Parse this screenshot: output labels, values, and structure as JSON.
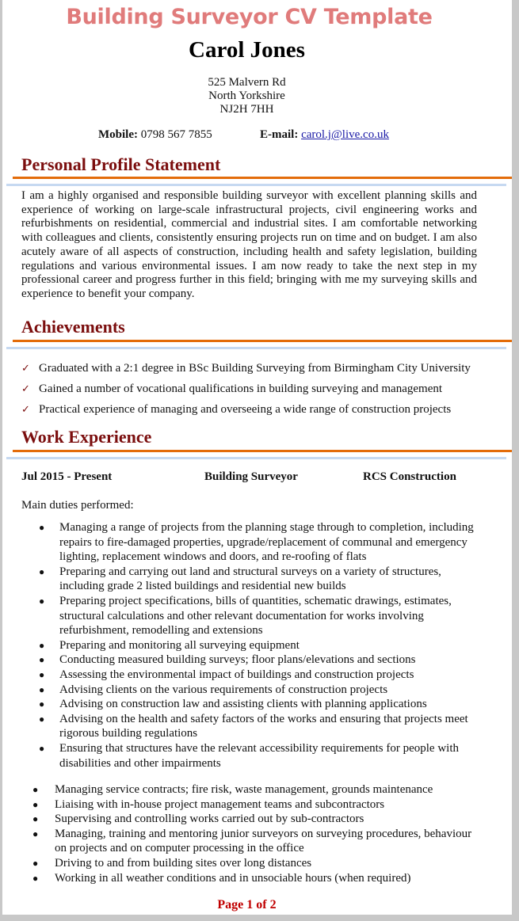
{
  "document": {
    "title": "Building Surveyor CV Template",
    "name": "Carol Jones",
    "address": [
      "525 Malvern Rd",
      "North Yorkshire",
      "NJ2H 7HH"
    ],
    "contact": {
      "mobile_label": "Mobile:",
      "mobile": "0798 567 7855",
      "email_label": "E-mail:",
      "email": "carol.j@live.co.uk"
    },
    "colors": {
      "title": "#e07b7b",
      "section_heading": "#7b0e0e",
      "rule_orange": "#e36c0a",
      "rule_blue": "#c6d9f1",
      "page_number": "#c00000"
    }
  },
  "profile": {
    "heading": "Personal Profile Statement",
    "text": "I am a highly organised and responsible building surveyor with excellent planning skills and experience of working on large-scale infrastructural projects, civil engineering works and refurbishments on residential, commercial and industrial sites. I am comfortable networking with colleagues and clients, consistently ensuring projects run on time and on budget. I am also acutely aware of all aspects of construction, including health and safety legislation, building regulations and various environmental issues. I am now ready to take the next step in my professional career and progress further in this field; bringing with me my surveying skills and experience to benefit your company."
  },
  "achievements": {
    "heading": "Achievements",
    "icon": "checkmark-icon",
    "items": [
      "Graduated with a 2:1 degree in BSc Building Surveying from Birmingham City University",
      "Gained a number of vocational qualifications in building surveying and management",
      "Practical experience of managing and overseeing a wide range of construction projects"
    ]
  },
  "work": {
    "heading": "Work Experience",
    "job": {
      "dates": "Jul 2015 - Present",
      "title": "Building Surveyor",
      "company": "RCS Construction"
    },
    "duties_label": "Main duties performed:",
    "duties_primary": [
      "Managing a range of projects from the planning stage through to completion, including repairs to fire-damaged properties, upgrade/replacement of communal and emergency lighting, replacement windows and doors, and re-roofing of flats",
      "Preparing and carrying out land and structural surveys on a variety of structures, including grade 2 listed buildings and residential new builds",
      "Preparing project specifications, bills of quantities, schematic drawings, estimates, structural calculations and other relevant documentation for works involving refurbishment, remodelling and extensions",
      "Preparing and monitoring all surveying equipment",
      "Conducting measured building surveys; floor plans/elevations and sections",
      "Assessing the environmental impact of buildings and construction projects",
      "Advising clients on the various requirements of construction projects",
      "Advising on construction law and assisting clients with planning applications",
      "Advising on the health and safety factors of the works and ensuring that projects meet rigorous building regulations",
      "Ensuring that structures have the relevant accessibility requirements for people with disabilities and other impairments"
    ],
    "duties_secondary": [
      "Managing service contracts; fire risk, waste management, grounds maintenance",
      "Liaising with in-house project management teams and subcontractors",
      "Supervising and controlling works carried out by sub-contractors",
      "Managing, training and mentoring junior surveyors on surveying procedures, behaviour on projects and on computer processing in the office",
      "Driving to and from building sites over long distances",
      "Working in all weather conditions and in unsociable hours (when required)"
    ]
  },
  "footer": {
    "page_number": "Page 1 of 2"
  }
}
